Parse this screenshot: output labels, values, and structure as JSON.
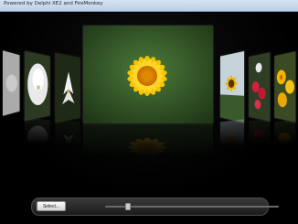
{
  "window": {
    "title": "Powered by Delphi XE2 and FireMonkey"
  },
  "toolbar": {
    "select_label": "Select..."
  },
  "slider": {
    "value": 0.12
  },
  "colors": {
    "background": "#000000",
    "flower_yellow": "#f5b800",
    "flower_center": "#e07a00",
    "leaf_green": "#2f5a26"
  },
  "gallery": {
    "items": [
      {
        "name": "white-flowers"
      },
      {
        "name": "white-lily"
      },
      {
        "name": "yellow-daisy"
      },
      {
        "name": "sunflower"
      },
      {
        "name": "red-flowers"
      },
      {
        "name": "yellow-flowers"
      }
    ]
  }
}
